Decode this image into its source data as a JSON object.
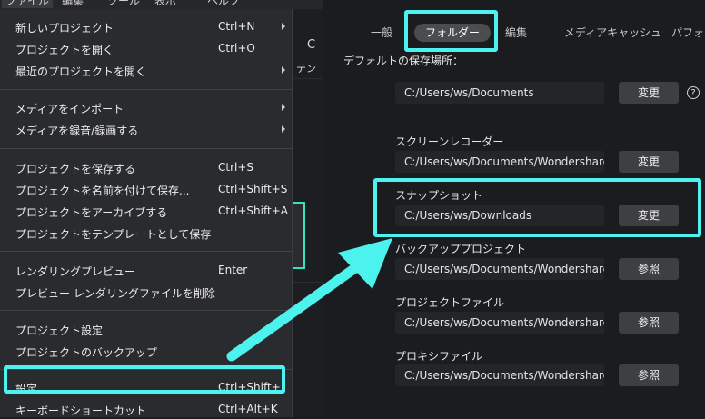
{
  "menubar": {
    "items": [
      "ファイル",
      "編集",
      "ツール",
      "表示",
      "ヘルプ"
    ]
  },
  "background_panel": {
    "text_1": "テン",
    "text_2": "C"
  },
  "file_menu": {
    "items": [
      {
        "label": "新しいプロジェクト",
        "shortcut": "Ctrl+N",
        "submenu": true
      },
      {
        "label": "プロジェクトを開く",
        "shortcut": "Ctrl+O",
        "submenu": false
      },
      {
        "label": "最近のプロジェクトを開く",
        "shortcut": "",
        "submenu": true
      },
      {
        "label": "メディアをインポート",
        "shortcut": "",
        "submenu": true
      },
      {
        "label": "メディアを録音/録画する",
        "shortcut": "",
        "submenu": true
      },
      {
        "label": "プロジェクトを保存する",
        "shortcut": "Ctrl+S",
        "submenu": false
      },
      {
        "label": "プロジェクトを名前を付けて保存...",
        "shortcut": "Ctrl+Shift+S",
        "submenu": false
      },
      {
        "label": "プロジェクトをアーカイブする",
        "shortcut": "Ctrl+Shift+A",
        "submenu": false
      },
      {
        "label": "プロジェクトをテンプレートとして保存",
        "shortcut": "",
        "submenu": false
      },
      {
        "label": "レンダリングプレビュー",
        "shortcut": "Enter",
        "submenu": false
      },
      {
        "label": "プレビュー レンダリングファイルを削除",
        "shortcut": "",
        "submenu": false
      },
      {
        "label": "プロジェクト設定",
        "shortcut": "",
        "submenu": false
      },
      {
        "label": "プロジェクトのバックアップ",
        "shortcut": "",
        "submenu": false
      },
      {
        "label": "設定",
        "shortcut": "Ctrl+Shift+,",
        "submenu": false
      },
      {
        "label": "キーボードショートカット",
        "shortcut": "Ctrl+Alt+K",
        "submenu": false
      }
    ]
  },
  "preferences": {
    "tabs": [
      {
        "label": "一般",
        "active": false
      },
      {
        "label": "フォルダー",
        "active": true
      },
      {
        "label": "編集",
        "active": false
      },
      {
        "label": "メディアキャッシュ",
        "active": false
      },
      {
        "label": "パフォーマ",
        "active": false
      }
    ],
    "default_location_label": "デフォルトの保存場所：",
    "default_location": {
      "path": "C:/Users/ws/Documents",
      "button": "変更"
    },
    "folders": [
      {
        "label": "スクリーンレコーダー",
        "path": "C:/Users/ws/Documents/Wondershare/W",
        "button": "変更"
      },
      {
        "label": "スナップショット",
        "path": "C:/Users/ws/Downloads",
        "button": "変更"
      },
      {
        "label": "バックアッププロジェクト",
        "path": "C:/Users/ws/Documents/Wondershare/W",
        "button": "参照"
      },
      {
        "label": "プロジェクトファイル",
        "path": "C:/Users/ws/Documents/Wondershare/W",
        "button": "参照"
      },
      {
        "label": "プロキシファイル",
        "path": "C:/Users/ws/Documents/Wondershare/W",
        "button": "参照"
      }
    ],
    "help_glyph": "?"
  },
  "annotation": {
    "highlight_color": "#4cf2ee"
  }
}
